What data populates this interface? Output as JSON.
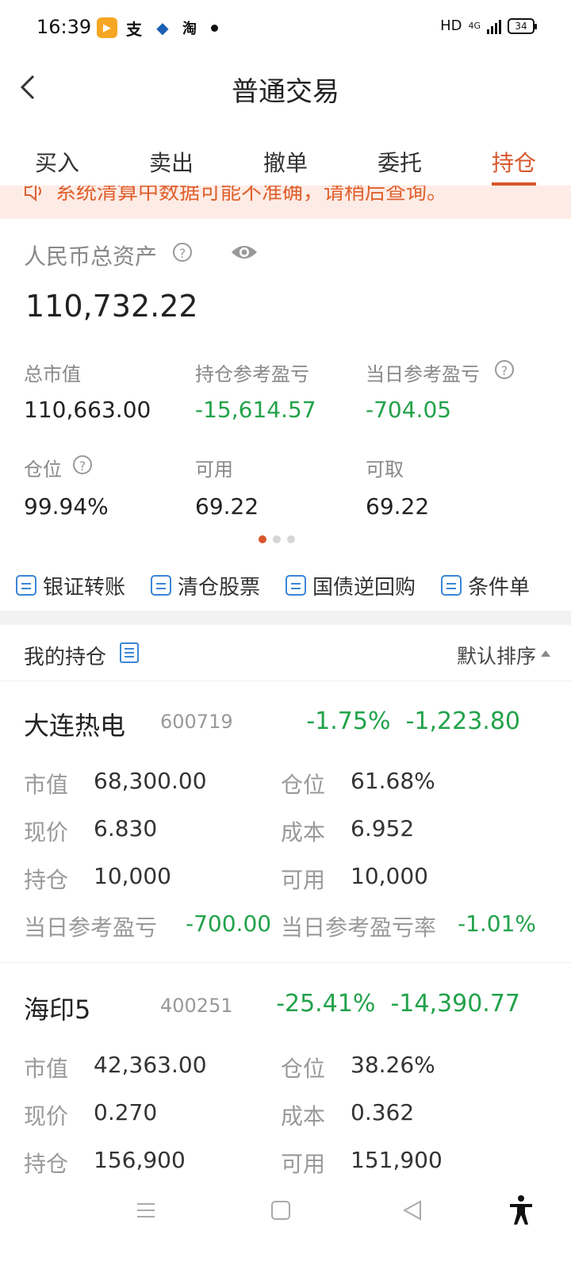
{
  "status_bar": {
    "time": "16:39",
    "apps": [
      "video-app-icon",
      "alipay-icon",
      "bank-icon",
      "taobao-icon"
    ],
    "network": "HD",
    "signal": "4G",
    "battery": "34"
  },
  "header": {
    "title": "普通交易",
    "back_icon": "chevron-left-icon"
  },
  "tabs": [
    {
      "label": "买入"
    },
    {
      "label": "卖出"
    },
    {
      "label": "撤单"
    },
    {
      "label": "委托"
    },
    {
      "label": "持仓",
      "active": true
    }
  ],
  "notice": {
    "text": "系统清算中数据可能不准确，请稍后查询。"
  },
  "assets": {
    "total_label": "人民币总资产",
    "total_value": "110,732.22",
    "market_value_label": "总市值",
    "market_value": "110,663.00",
    "hold_pnl_label": "持仓参考盈亏",
    "hold_pnl": "-15,614.57",
    "day_pnl_label": "当日参考盈亏",
    "day_pnl": "-704.05",
    "position_label": "仓位",
    "position": "99.94%",
    "available_label": "可用",
    "available": "69.22",
    "withdrawable_label": "可取",
    "withdrawable": "69.22"
  },
  "quick_actions": [
    {
      "label": "银证转账",
      "icon": "transfer-icon"
    },
    {
      "label": "清仓股票",
      "icon": "clear-chart-icon"
    },
    {
      "label": "国债逆回购",
      "icon": "repo-icon"
    },
    {
      "label": "条件单",
      "icon": "condition-order-icon"
    }
  ],
  "holdings": {
    "title": "我的持仓",
    "sort_label": "默认排序",
    "field_labels": {
      "market_value": "市值",
      "position": "仓位",
      "price": "现价",
      "cost": "成本",
      "holding": "持仓",
      "available": "可用",
      "day_pnl": "当日参考盈亏",
      "day_pnl_rate": "当日参考盈亏率"
    },
    "stocks": [
      {
        "name": "大连热电",
        "code": "600719",
        "pct": "-1.75%",
        "pnl": "-1,223.80",
        "market_value": "68,300.00",
        "position": "61.68%",
        "price": "6.830",
        "cost": "6.952",
        "holding": "10,000",
        "available": "10,000",
        "day_pnl": "-700.00",
        "day_pnl_rate": "-1.01%"
      },
      {
        "name": "海印5",
        "code": "400251",
        "pct": "-25.41%",
        "pnl": "-14,390.77",
        "market_value": "42,363.00",
        "position": "38.26%",
        "price": "0.270",
        "cost": "0.362",
        "holding": "156,900",
        "available": "151,900"
      }
    ]
  },
  "colors": {
    "accent": "#d8562c",
    "loss": "#22a24a",
    "link": "#3a86d6"
  },
  "carousel": {
    "pages": 3,
    "current": 1
  }
}
